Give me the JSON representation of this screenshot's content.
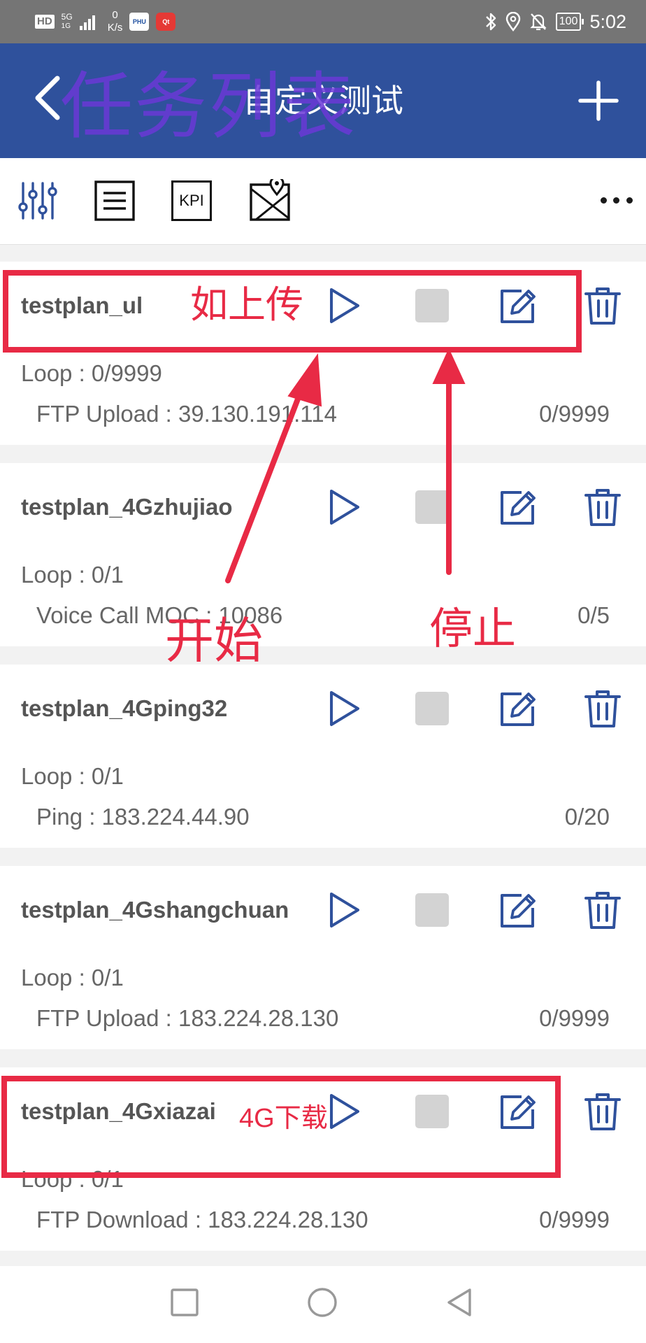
{
  "status_bar": {
    "hd": "HD",
    "network": "5G",
    "network_sub": "1G",
    "speed_value": "0",
    "speed_unit": "K/s",
    "app_icon_1": "PHU",
    "app_icon_2": "Qt",
    "battery": "100",
    "time": "5:02",
    "icons": [
      "bluetooth-icon",
      "location-icon",
      "bell-off-icon",
      "battery-icon"
    ]
  },
  "header": {
    "title": "自定义测试",
    "overlay_annotation": "任务列表",
    "back_icon": "chevron-left-icon",
    "add_icon": "plus-icon"
  },
  "toolbar": {
    "items": [
      "sliders-icon",
      "list-icon",
      "kpi-icon",
      "map-icon"
    ],
    "kpi_label": "KPI",
    "more_icon": "more-dots-icon"
  },
  "tasks": [
    {
      "name": "testplan_ul",
      "loop": "Loop : 0/9999",
      "detail": "FTP Upload : 39.130.191.114",
      "count": "0/9999"
    },
    {
      "name": "testplan_4Gzhujiao",
      "loop": "Loop : 0/1",
      "detail": "Voice Call MOC : 10086",
      "count": "0/5"
    },
    {
      "name": "testplan_4Gping32",
      "loop": "Loop : 0/1",
      "detail": "Ping : 183.224.44.90",
      "count": "0/20"
    },
    {
      "name": "testplan_4Gshangchuan",
      "loop": "Loop : 0/1",
      "detail": "FTP Upload : 183.224.28.130",
      "count": "0/9999"
    },
    {
      "name": "testplan_4Gxiazai",
      "loop": "Loop : 0/1",
      "detail": "FTP Download : 183.224.28.130",
      "count": "0/9999"
    }
  ],
  "annotations": {
    "upload": "如上传",
    "start": "开始",
    "stop": "停止",
    "download_4g": "4G下载",
    "color": "#e82a45"
  },
  "colors": {
    "header_bg": "#2f519c",
    "status_bg": "#757575",
    "icon_blue": "#2f519c",
    "overlay_purple": "#6a39d6"
  },
  "nav": [
    "square-recents-icon",
    "circle-home-icon",
    "triangle-back-icon"
  ]
}
